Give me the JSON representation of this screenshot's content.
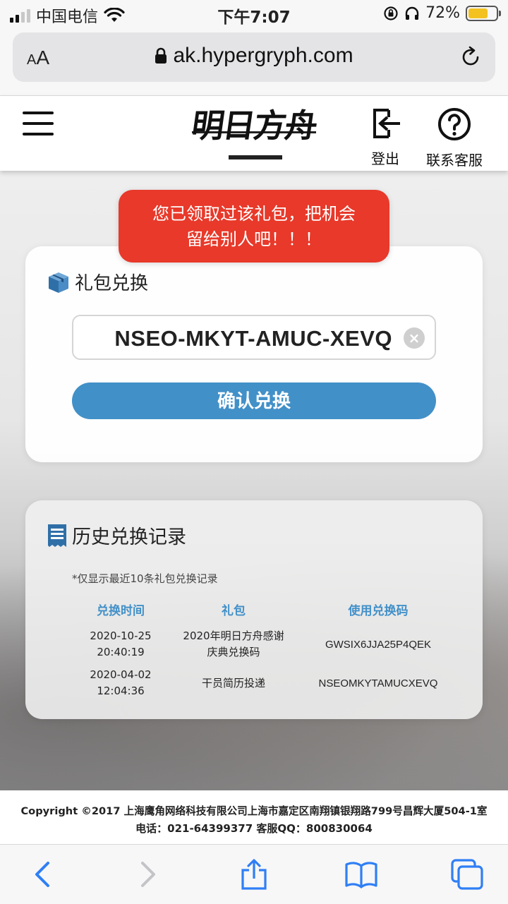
{
  "status_bar": {
    "carrier": "中国电信",
    "time": "下午7:07",
    "battery": "72%",
    "battery_level": 0.72
  },
  "browser": {
    "text_size_label": "AA",
    "url": "ak.hypergryph.com"
  },
  "header": {
    "logo_text": "明日方舟",
    "logout_label": "登出",
    "support_label": "联系客服"
  },
  "toast": {
    "line1": "您已领取过该礼包，把机会",
    "line2": "留给别人吧！！！"
  },
  "redeem": {
    "title": "礼包兑换",
    "code_value": "NSEO-MKYT-AMUC-XEVQ",
    "confirm_label": "确认兑换"
  },
  "history": {
    "title": "历史兑换记录",
    "note": "*仅显示最近10条礼包兑换记录",
    "columns": [
      "兑换时间",
      "礼包",
      "使用兑换码"
    ],
    "rows": [
      {
        "date": "2020-10-25",
        "time": "20:40:19",
        "gift_line1": "2020年明日方舟感谢",
        "gift_line2": "庆典兑换码",
        "code": "GWSIX6JJA25P4QEK"
      },
      {
        "date": "2020-04-02",
        "time": "12:04:36",
        "gift_line1": "干员简历投递",
        "gift_line2": "",
        "code": "NSEOMKYTAMUCXEVQ"
      }
    ]
  },
  "footer": {
    "line1": "Copyright ©2017 上海鹰角网络科技有限公司上海市嘉定区南翔镇银翔路799号昌辉大厦504-1室",
    "line2": "电话：021-64399377 客服QQ：800830064"
  },
  "toolbar": {
    "icons": [
      "back-icon",
      "forward-icon",
      "share-icon",
      "bookmarks-icon",
      "tabs-icon"
    ]
  },
  "colors": {
    "accent": "#4290c8",
    "toast": "#e8392a"
  }
}
